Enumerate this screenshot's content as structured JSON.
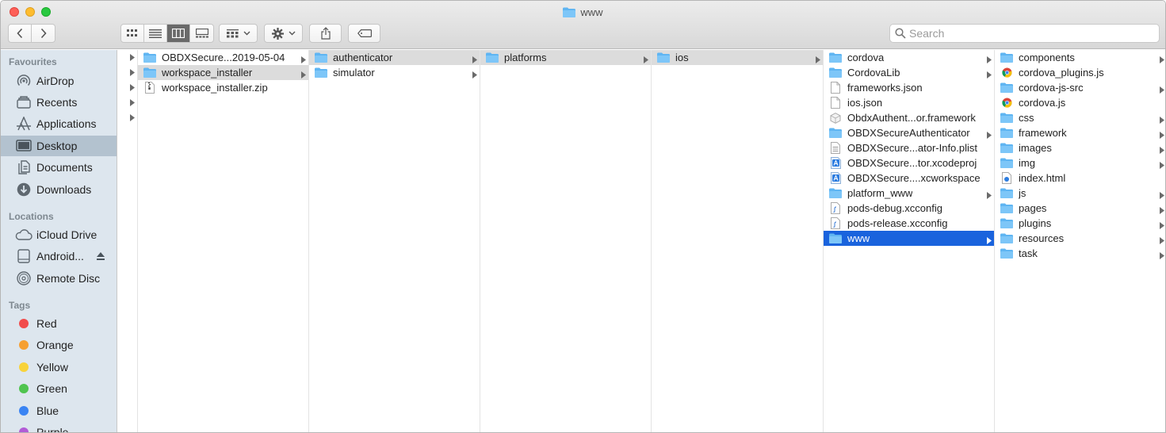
{
  "window": {
    "title": "www"
  },
  "toolbar": {
    "search_placeholder": "Search"
  },
  "sidebar": {
    "favourites_title": "Favourites",
    "favourites": [
      {
        "label": "AirDrop",
        "icon": "airdrop-icon"
      },
      {
        "label": "Recents",
        "icon": "recents-icon"
      },
      {
        "label": "Applications",
        "icon": "applications-icon"
      },
      {
        "label": "Desktop",
        "icon": "desktop-icon",
        "selected": true
      },
      {
        "label": "Documents",
        "icon": "documents-icon"
      },
      {
        "label": "Downloads",
        "icon": "downloads-icon"
      }
    ],
    "locations_title": "Locations",
    "locations": [
      {
        "label": "iCloud Drive",
        "icon": "cloud-icon"
      },
      {
        "label": "Android...",
        "icon": "drive-icon",
        "eject": true
      },
      {
        "label": "Remote Disc",
        "icon": "disc-icon"
      }
    ],
    "tags_title": "Tags",
    "tags": [
      {
        "label": "Red",
        "color": "#f14c4c"
      },
      {
        "label": "Orange",
        "color": "#f6a032"
      },
      {
        "label": "Yellow",
        "color": "#f8d33a"
      },
      {
        "label": "Green",
        "color": "#4fc44f"
      },
      {
        "label": "Blue",
        "color": "#3a84f3"
      },
      {
        "label": "Purple",
        "color": "#b25bd6"
      }
    ]
  },
  "columns": {
    "col1": [
      {
        "name": "OBDXSecure...2019-05-04",
        "type": "folder",
        "chevron": true
      },
      {
        "name": "workspace_installer",
        "type": "folder",
        "chevron": true,
        "state": "path"
      },
      {
        "name": "workspace_installer.zip",
        "type": "zip"
      }
    ],
    "col2": [
      {
        "name": "authenticator",
        "type": "folder",
        "chevron": true,
        "state": "path"
      },
      {
        "name": "simulator",
        "type": "folder",
        "chevron": true
      }
    ],
    "col3": [
      {
        "name": "platforms",
        "type": "folder",
        "chevron": true,
        "state": "path"
      }
    ],
    "col4": [
      {
        "name": "ios",
        "type": "folder",
        "chevron": true,
        "state": "path"
      }
    ],
    "col5": [
      {
        "name": "cordova",
        "type": "folder",
        "chevron": true
      },
      {
        "name": "CordovaLib",
        "type": "folder",
        "chevron": true
      },
      {
        "name": "frameworks.json",
        "type": "doc"
      },
      {
        "name": "ios.json",
        "type": "doc"
      },
      {
        "name": "ObdxAuthent...or.framework",
        "type": "framework"
      },
      {
        "name": "OBDXSecureAuthenticator",
        "type": "folder",
        "chevron": true
      },
      {
        "name": "OBDXSecure...ator-Info.plist",
        "type": "plist"
      },
      {
        "name": "OBDXSecure...tor.xcodeproj",
        "type": "xcode"
      },
      {
        "name": "OBDXSecure....xcworkspace",
        "type": "xcode"
      },
      {
        "name": "platform_www",
        "type": "folder",
        "chevron": true
      },
      {
        "name": "pods-debug.xcconfig",
        "type": "config"
      },
      {
        "name": "pods-release.xcconfig",
        "type": "config"
      },
      {
        "name": "www",
        "type": "folder",
        "chevron": true,
        "state": "selected"
      }
    ],
    "col6": [
      {
        "name": "components",
        "type": "folder",
        "chevron": true
      },
      {
        "name": "cordova_plugins.js",
        "type": "chrome"
      },
      {
        "name": "cordova-js-src",
        "type": "folder",
        "chevron": true
      },
      {
        "name": "cordova.js",
        "type": "chrome"
      },
      {
        "name": "css",
        "type": "folder",
        "chevron": true
      },
      {
        "name": "framework",
        "type": "folder",
        "chevron": true
      },
      {
        "name": "images",
        "type": "folder",
        "chevron": true
      },
      {
        "name": "img",
        "type": "folder",
        "chevron": true
      },
      {
        "name": "index.html",
        "type": "html"
      },
      {
        "name": "js",
        "type": "folder",
        "chevron": true
      },
      {
        "name": "pages",
        "type": "folder",
        "chevron": true
      },
      {
        "name": "plugins",
        "type": "folder",
        "chevron": true
      },
      {
        "name": "resources",
        "type": "folder",
        "chevron": true
      },
      {
        "name": "task",
        "type": "folder",
        "chevron": true
      }
    ]
  }
}
